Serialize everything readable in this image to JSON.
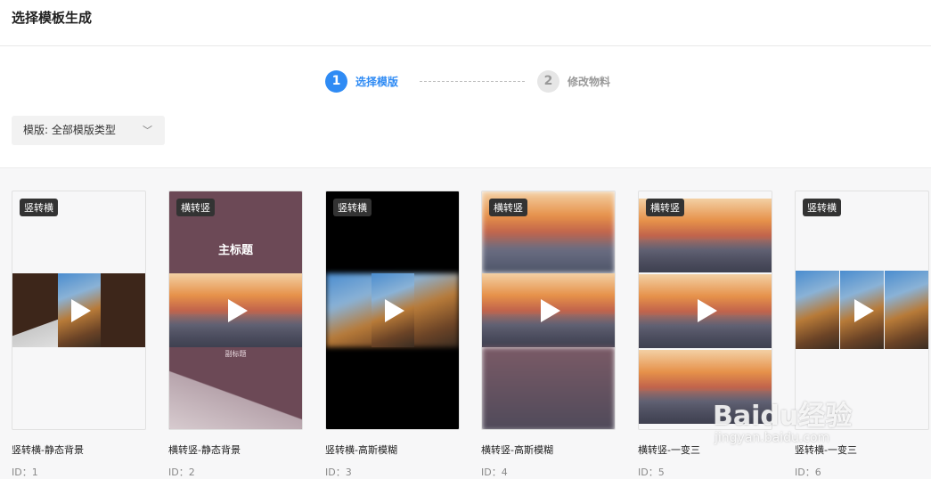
{
  "header": {
    "title": "选择模板生成"
  },
  "steps": [
    {
      "number": "1",
      "label": "选择模版",
      "state": "active"
    },
    {
      "number": "2",
      "label": "修改物料",
      "state": "inactive"
    }
  ],
  "filter": {
    "label": "模版: 全部模版类型"
  },
  "cards": [
    {
      "badge": "竖转横",
      "name": "竖转横-静态背景",
      "id": "ID：1"
    },
    {
      "badge": "横转竖",
      "name": "横转竖-静态背景",
      "id": "ID：2",
      "thumb_title": "主标题",
      "thumb_subtitle": "副标题"
    },
    {
      "badge": "竖转横",
      "name": "竖转横-高斯模糊",
      "id": "ID：3"
    },
    {
      "badge": "横转竖",
      "name": "横转竖-高斯模糊",
      "id": "ID：4"
    },
    {
      "badge": "横转竖",
      "name": "横转竖-一变三",
      "id": "ID：5"
    },
    {
      "badge": "竖转横",
      "name": "竖转横-一变三",
      "id": "ID：6"
    }
  ],
  "watermark": {
    "brand": "Baidu经验",
    "url": "jingyan.baidu.com"
  },
  "colors": {
    "accent": "#2f8bf4",
    "badge_bg": "#333333"
  }
}
